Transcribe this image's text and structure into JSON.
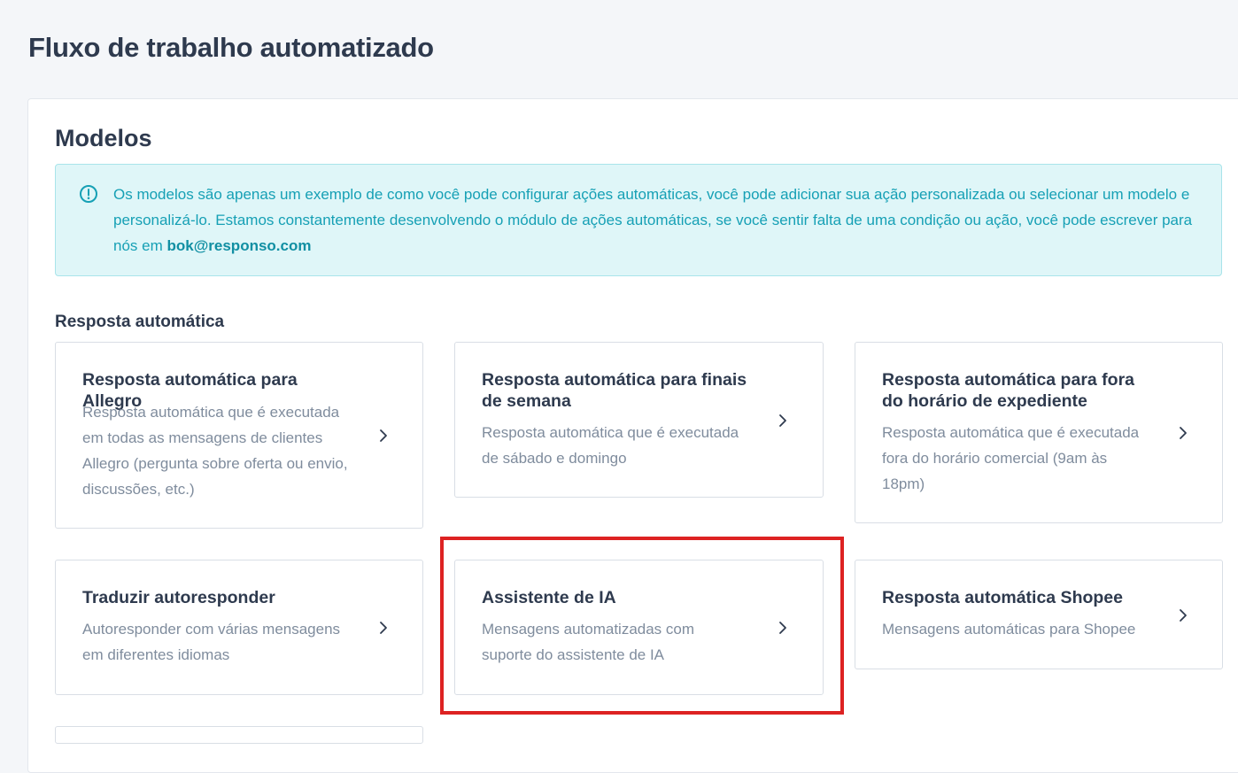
{
  "page": {
    "title": "Fluxo de trabalho automatizado"
  },
  "templates": {
    "title": "Modelos",
    "info": {
      "icon": "info-circle-icon",
      "text": "Os modelos são apenas um exemplo de como você pode configurar ações automáticas, você pode adicionar sua ação personalizada ou selecionar um modelo e personalizá-lo. Estamos constantemente desenvolvendo o módulo de ações automáticas, se você sentir falta de uma condição ou ação, você pode escrever para nós em ",
      "email": "bok@responso.com"
    },
    "group_label": "Resposta automática",
    "cards": [
      {
        "title": "Resposta automática para Allegro",
        "description": "Resposta automática que é executada em todas as mensagens de clientes Allegro (pergunta sobre oferta ou envio, discussões, etc.)",
        "icon": "chevron-right-icon"
      },
      {
        "title": "Resposta automática para finais de semana",
        "description": "Resposta automática que é executada de sábado e domingo",
        "icon": "chevron-right-icon"
      },
      {
        "title": "Resposta automática para fora do horário de expediente",
        "description": "Resposta automática que é executada fora do horário comercial (9am às 18pm)",
        "icon": "chevron-right-icon"
      },
      {
        "title": "Traduzir autoresponder",
        "description": "Autoresponder com várias mensagens em diferentes idiomas",
        "icon": "chevron-right-icon"
      },
      {
        "title": "Assistente de IA",
        "description": "Mensagens automatizadas com suporte do assistente de IA",
        "icon": "chevron-right-icon"
      },
      {
        "title": "Resposta automática Shopee",
        "description": "Mensagens automáticas para Shopee",
        "icon": "chevron-right-icon"
      }
    ]
  },
  "colors": {
    "accent_teal": "#16a0b5",
    "info_background": "#dff6f8",
    "highlight_red": "#dd2222",
    "heading_text": "#2e3a4e",
    "muted_text": "#7f8c9d"
  }
}
